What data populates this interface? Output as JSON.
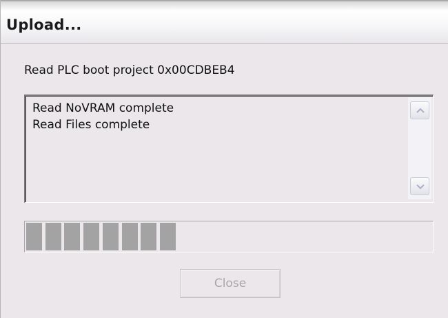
{
  "window": {
    "title": "Upload..."
  },
  "status": {
    "message": "Read PLC boot project 0x00CDBEB4"
  },
  "log": {
    "lines": [
      "Read NoVRAM complete",
      "Read Files complete"
    ]
  },
  "progress": {
    "fraction": 0.38,
    "total_chunks": 21
  },
  "buttons": {
    "close_label": "Close",
    "close_enabled": false
  },
  "icons": {
    "scroll_up": "scroll-up-arrow-icon",
    "scroll_down": "scroll-down-arrow-icon"
  },
  "colors": {
    "dialog_bg": "#ebe7ea",
    "progress_chunk": "#a3a3a3",
    "disabled_text": "#a9a6a8"
  }
}
